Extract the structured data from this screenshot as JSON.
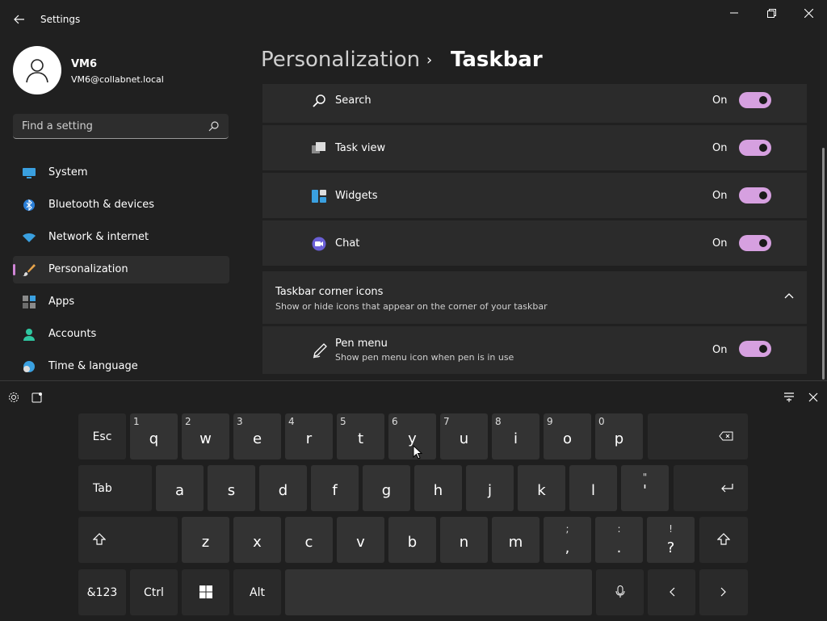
{
  "app": {
    "title": "Settings"
  },
  "user": {
    "name": "VM6",
    "email": "VM6@collabnet.local"
  },
  "search": {
    "placeholder": "Find a setting"
  },
  "sidebar": {
    "items": [
      {
        "label": "System",
        "icon": "monitor-icon"
      },
      {
        "label": "Bluetooth & devices",
        "icon": "bluetooth-icon"
      },
      {
        "label": "Network & internet",
        "icon": "wifi-icon"
      },
      {
        "label": "Personalization",
        "icon": "brush-icon",
        "active": true
      },
      {
        "label": "Apps",
        "icon": "apps-icon"
      },
      {
        "label": "Accounts",
        "icon": "person-icon"
      },
      {
        "label": "Time & language",
        "icon": "globe-clock-icon"
      }
    ]
  },
  "breadcrumb": {
    "parent": "Personalization",
    "separator": "›",
    "current": "Taskbar"
  },
  "taskbar_items": [
    {
      "label": "Search",
      "state": "On",
      "icon": "search-icon"
    },
    {
      "label": "Task view",
      "state": "On",
      "icon": "taskview-icon"
    },
    {
      "label": "Widgets",
      "state": "On",
      "icon": "widgets-icon"
    },
    {
      "label": "Chat",
      "state": "On",
      "icon": "chat-icon"
    }
  ],
  "corner_section": {
    "title": "Taskbar corner icons",
    "subtitle": "Show or hide icons that appear on the corner of your taskbar",
    "items": [
      {
        "label": "Pen menu",
        "description": "Show pen menu icon when pen is in use",
        "state": "On",
        "icon": "pen-icon"
      }
    ]
  },
  "colors": {
    "accent": "#d6a0e0",
    "background": "#202020",
    "card": "#2b2b2b"
  },
  "keyboard": {
    "row1": [
      {
        "main": "Esc"
      },
      {
        "main": "q",
        "alt": "1"
      },
      {
        "main": "w",
        "alt": "2"
      },
      {
        "main": "e",
        "alt": "3"
      },
      {
        "main": "r",
        "alt": "4"
      },
      {
        "main": "t",
        "alt": "5"
      },
      {
        "main": "y",
        "alt": "6"
      },
      {
        "main": "u",
        "alt": "7"
      },
      {
        "main": "i",
        "alt": "8"
      },
      {
        "main": "o",
        "alt": "9"
      },
      {
        "main": "p",
        "alt": "0"
      }
    ],
    "row2": [
      {
        "main": "Tab"
      },
      {
        "main": "a"
      },
      {
        "main": "s"
      },
      {
        "main": "d"
      },
      {
        "main": "f"
      },
      {
        "main": "g"
      },
      {
        "main": "h"
      },
      {
        "main": "j"
      },
      {
        "main": "k"
      },
      {
        "main": "l"
      },
      {
        "main": "'",
        "alt": "\""
      }
    ],
    "row3": [
      {
        "main": "z"
      },
      {
        "main": "x"
      },
      {
        "main": "c"
      },
      {
        "main": "v"
      },
      {
        "main": "b"
      },
      {
        "main": "n"
      },
      {
        "main": "m"
      },
      {
        "main": ",",
        "alt": ";"
      },
      {
        "main": ".",
        "alt": ":"
      },
      {
        "main": "?",
        "alt": "!"
      }
    ],
    "row4": {
      "symbols": "&123",
      "ctrl": "Ctrl",
      "alt": "Alt"
    }
  }
}
